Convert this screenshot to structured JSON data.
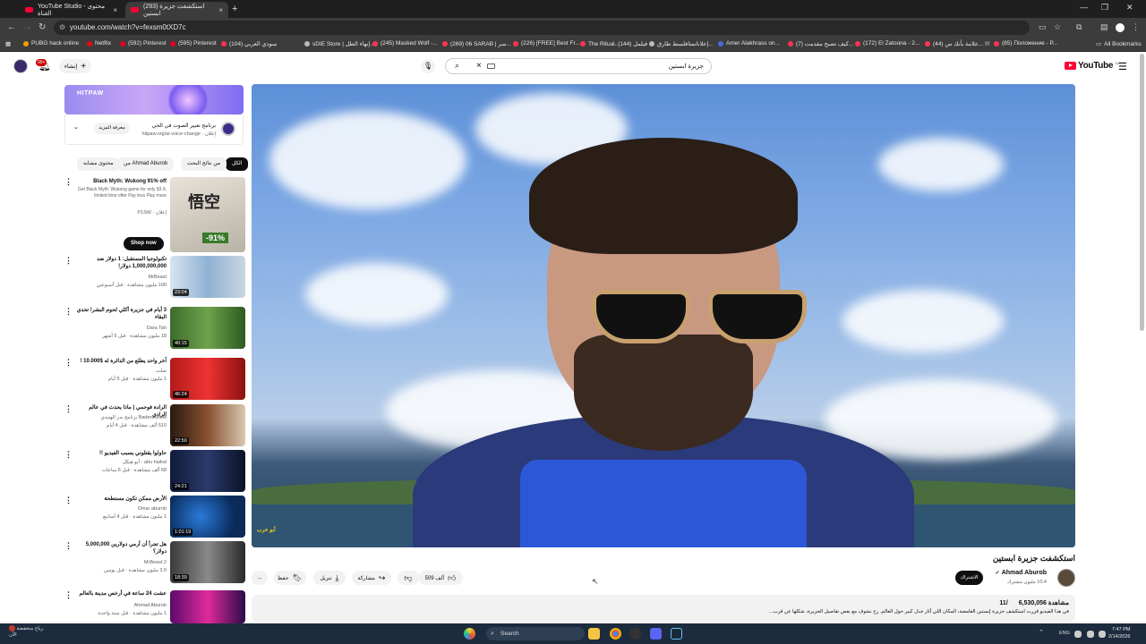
{
  "browser": {
    "tabs": [
      {
        "label": "YouTube Studio - محتوى القناة"
      },
      {
        "label": "(293) استكشفت جزيرة ابستين"
      }
    ],
    "url": "youtube.com/watch?v=fexsm0tXD7c",
    "bookmarks": [
      "PUBG hack online",
      "Netflix",
      "(592) Pinterest",
      "(595) Pinterest",
      "(104) سودي العربي",
      "sDIE Store | إنهاء الطل...",
      "(245) Masked Wolf -...",
      "(269) 06 SARAB | سر...",
      "(226) [FREE] Best Fr...",
      "The Ritual..فيلمل (144)",
      "إعلاناتمتافلسط طارق...",
      "Amer Alakhrass on...",
      "(7) كيف تصبح مقدمت...",
      "(172) El Zatoona - 2...",
      "(44) علامة بأنك س... !!!",
      "(85) Положение - Р..."
    ],
    "all_bookmarks": "All Bookmarks"
  },
  "header": {
    "notif_count": "99+",
    "create_label": "إنشاء",
    "search_query": "جزيرة ابستين",
    "logo_text": "YouTube",
    "logo_cc": "SA"
  },
  "ad": {
    "banner_text": "HITPAW",
    "title": "برنامج تغيير الصوت في الحي",
    "url": "إعلان · hitpaw.org/ai-voice-change",
    "more_label": "معرفة المزيد"
  },
  "chips": [
    "الكل",
    "من نتائج البحث",
    "من Ahmad Aburob",
    "محتوى مشابه"
  ],
  "sidebar": [
    {
      "title": "Black Myth: Wukong 91% off",
      "channel": "Get Black Myth: Wukong game for only $3.9, limited time offer Pay less Play more",
      "meta": "إعلان · P1SW",
      "dur": "",
      "action": "Shop now",
      "thumb_text": "-91%"
    },
    {
      "title": "تكنولوجيا المستقبل: 1 دولار ضد 1,000,000,000 دولار!",
      "channel": "MrBeast",
      "meta": "100 مليون مشاهدة · قبل أسبوعين",
      "dur": "23:04"
    },
    {
      "title": "3 أيام في جزيرة أكلي لحوم البشر! تحدي البقاء",
      "channel": "Dara Tah",
      "meta": "18 مليون مشاهدة · قبل 5 أشهر",
      "dur": "40:15"
    },
    {
      "title": "آخر واحد يطلع من الدائرة له $10.000 !",
      "channel": "صلت",
      "meta": "1 مليون مشاهدة · قبل 5 أيام",
      "dur": "46:24"
    },
    {
      "title": "الرادة فوحمي | ماذا يحدث في عالم الرادي",
      "channel": "BadersShow برنامج بدر الهنيدي",
      "meta": "510 ألف مشاهدة · قبل 4 أيام",
      "dur": "22:50"
    },
    {
      "title": "حاولوا يقتلوني بسبب الفيديو !!",
      "channel": "abu haikal - أبو هيكل",
      "meta": "68 ألف مشاهدة · قبل 6 ساعات",
      "dur": "24:21"
    },
    {
      "title": "الأرض ممكن تكون مستطحة",
      "channel": "Omar aburob",
      "meta": "1 مليون مشاهدة · قبل 4 أسابيع",
      "dur": "1:01:19"
    },
    {
      "title": "هل تجرأ أن أرمي دولارين 5,000,000 دولار؟",
      "channel": "MrBeast 2",
      "meta": "3.9 مليون مشاهدة · قبل يومين",
      "dur": "18:39"
    },
    {
      "title": "عشت 24 ساعة في أرخص مدينة بالعالم",
      "channel": "Ahmad Aburob",
      "meta": "1 مليون مشاهدة · قبل سنة واحدة",
      "dur": ""
    }
  ],
  "video": {
    "title": "استكشفت جزيرة ابستين",
    "channel": "Ahmad Aburob",
    "subs": "10.4 مليون مشترك",
    "subscribed_label": "الاشتراك",
    "likes": "509 ألف",
    "share_label": "مشاركة",
    "download_label": "تنزيل",
    "save_label": "حفظ",
    "more_label": "...",
    "views": "6,530,056 مشاهدة",
    "date": "11/",
    "desc": "في هذا الفيديو قررت استكشف جزيرة إبستين الغامضة، المكان اللي أثار جدل كبير حول العالم. رح نشوف مع بعض تفاصيل الجزيرة، شكلها عن قرب...",
    "watermark": "أبو عرب"
  },
  "taskbar": {
    "weather_1": "رياح منخفضة",
    "weather_2": "الآن",
    "search": "Search",
    "lang": "ENG",
    "time": "7:47 PM",
    "date": "2/14/2026"
  }
}
